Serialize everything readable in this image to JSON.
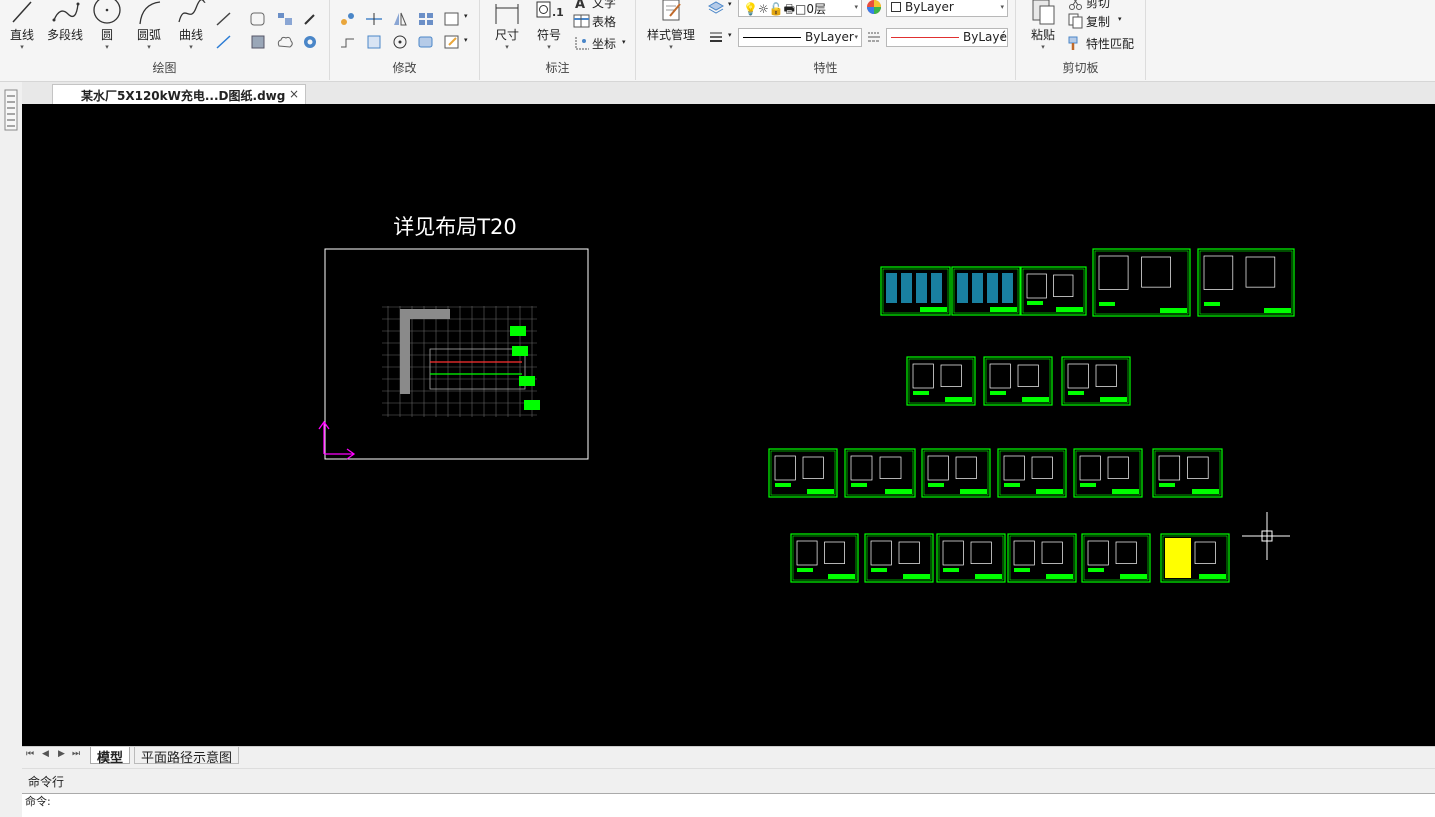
{
  "ribbon": {
    "draw": {
      "title": "绘图",
      "line": "直线",
      "polyline": "多段线",
      "circle": "圆",
      "arc": "圆弧",
      "curve": "曲线"
    },
    "modify": {
      "title": "修改"
    },
    "annotate": {
      "title": "标注",
      "dimension": "尺寸",
      "symbol": "符号",
      "text": "文字",
      "table": "表格",
      "coordinate": "坐标"
    },
    "properties": {
      "title": "特性",
      "style_manager": "样式管理",
      "layer_value": "0层",
      "color_value": "ByLayer",
      "linetype_value": "ByLayer",
      "lineweight_value": "ByLayé"
    },
    "clipboard": {
      "title": "剪切板",
      "paste": "粘贴",
      "cut": "剪切",
      "copy": "复制",
      "match": "特性匹配"
    }
  },
  "document": {
    "tab_title": "某水厂5X120kW充电...D图纸.dwg",
    "close_glyph": "×"
  },
  "canvas": {
    "layout_note": "详见布局T20"
  },
  "layout_tabs": {
    "model": "模型",
    "layout1": "平面路径示意图"
  },
  "command": {
    "header": "命令行",
    "prompt": "命令:"
  },
  "colors": {
    "canvas_bg": "#000000",
    "drawing_green": "#00ff00",
    "frame_white": "#ffffff",
    "ucs_magenta": "#ff00ff"
  }
}
